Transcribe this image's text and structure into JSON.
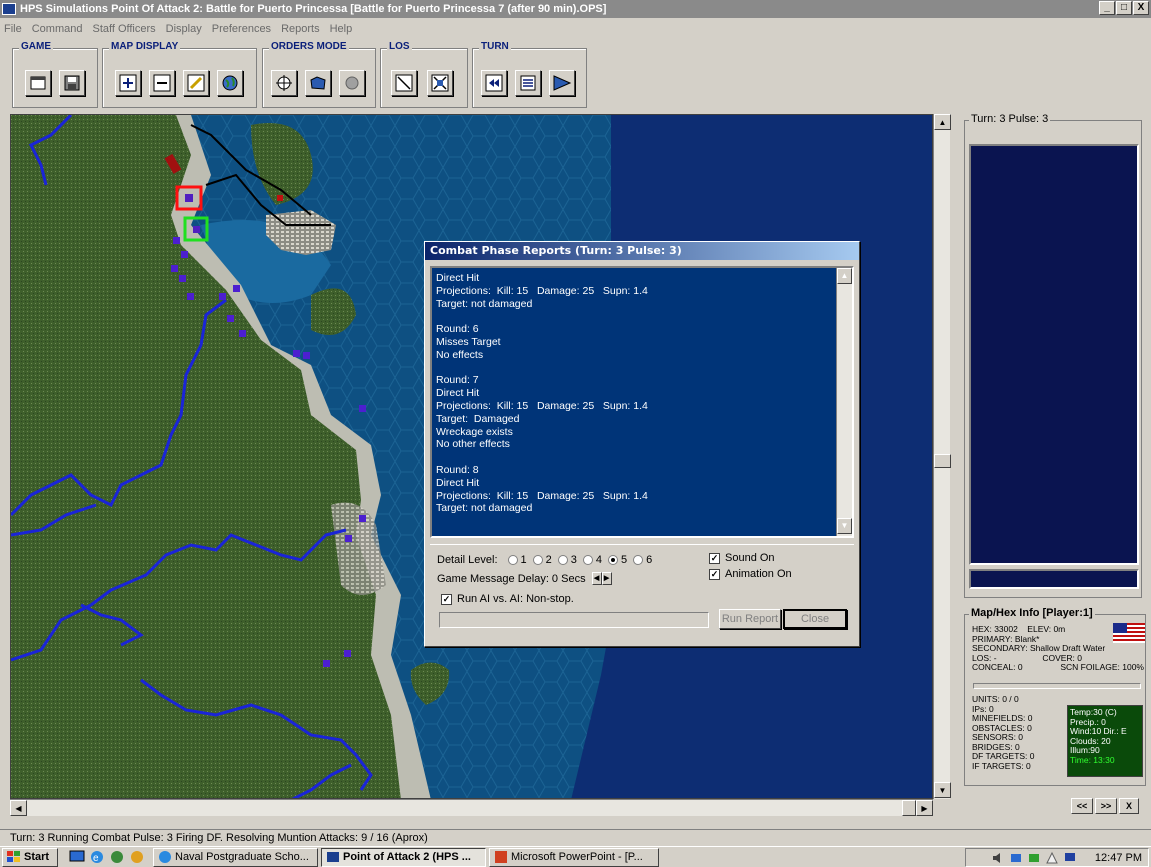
{
  "window": {
    "title": "HPS Simulations Point Of Attack 2:  Battle for Puerto Princessa  [Battle for Puerto Princessa 7 (after 90 min).OPS]",
    "min": "_",
    "max": "□",
    "close": "X"
  },
  "menu": [
    "File",
    "Command",
    "Staff Officers",
    "Display",
    "Preferences",
    "Reports",
    "Help"
  ],
  "toolbar": {
    "groups": [
      {
        "title": "GAME",
        "buttons": [
          "new-window-icon",
          "save-disk-icon"
        ]
      },
      {
        "title": "MAP DISPLAY",
        "buttons": [
          "zoom-in-icon",
          "zoom-out-icon",
          "pencil-icon",
          "globe-icon"
        ]
      },
      {
        "title": "ORDERS MODE",
        "buttons": [
          "crosshair-icon",
          "map-icon",
          "circle-icon"
        ]
      },
      {
        "title": "LOS",
        "buttons": [
          "los-line-icon",
          "los-blocked-icon"
        ]
      },
      {
        "title": "TURN",
        "buttons": [
          "rewind-icon",
          "report-icon",
          "play-icon"
        ]
      }
    ]
  },
  "combat_dialog": {
    "title": "Combat Phase Reports  (Turn: 3  Pulse: 3)",
    "lines": [
      "Direct Hit",
      "Projections:  Kill: 15   Damage: 25   Supn: 1.4",
      "Target: not damaged",
      "",
      "Round: 6",
      "Misses Target",
      "No effects",
      "",
      "Round: 7",
      "Direct Hit",
      "Projections:  Kill: 15   Damage: 25   Supn: 1.4",
      "Target:  Damaged",
      "Wreckage exists",
      "No other effects",
      "",
      "Round: 8",
      "Direct Hit",
      "Projections:  Kill: 15   Damage: 25   Supn: 1.4",
      "Target: not damaged"
    ],
    "detail_level_label": "Detail Level:",
    "detail_levels": [
      "1",
      "2",
      "3",
      "4",
      "5",
      "6"
    ],
    "detail_selected": "5",
    "sound_label": "Sound On",
    "animation_label": "Animation On",
    "delay_label": "Game Message Delay: 0 Secs",
    "run_ai_label": "Run AI vs. AI: Non-stop.",
    "run_report_label": "Run Report",
    "close_label": "Close"
  },
  "right_panel": {
    "turn_label": "Turn: 3  Pulse: 3",
    "map_info_title": "Map/Hex Info [Player:1]",
    "hex": "HEX: 33002",
    "elev": "ELEV: 0m",
    "primary": "PRIMARY: Blank*",
    "secondary": "SECONDARY: Shallow Draft Water",
    "los": "LOS: -",
    "cover": "COVER: 0",
    "conceal": "CONCEAL: 0",
    "scn_foilage": "SCN FOILAGE: 100%",
    "units": "UNITS: 0 / 0",
    "ips": "IPs: 0",
    "minefields": "MINEFIELDS: 0",
    "obstacles": "OBSTACLES: 0",
    "sensors": "SENSORS: 0",
    "bridges": "BRIDGES: 0",
    "df_targets": "DF TARGETS: 0",
    "if_targets": "IF TARGETS: 0",
    "weather": [
      "Temp:30 (C)",
      "Precip.: 0",
      "Wind:10  Dir.: E",
      "Clouds: 20",
      "Illum:90"
    ],
    "time": "Time: 13:30",
    "nav_prev": "<<",
    "nav_next": ">>",
    "nav_close": "X"
  },
  "status_text": "Turn: 3  Running Combat Pulse: 3  Firing DF.  Resolving Muntion Attacks: 9 / 16 (Aprox)",
  "taskbar": {
    "start": "Start",
    "tasks": [
      "Naval Postgraduate Scho...",
      "Point of Attack 2 (HPS ...",
      "Microsoft PowerPoint - [P..."
    ],
    "clock": "12:47 PM"
  },
  "colors": {
    "sea": "#0e5082",
    "land": "#3b5a2a",
    "river": "#1a24d8",
    "dialog_title": "#0a246a",
    "report_bg": "#003478"
  }
}
